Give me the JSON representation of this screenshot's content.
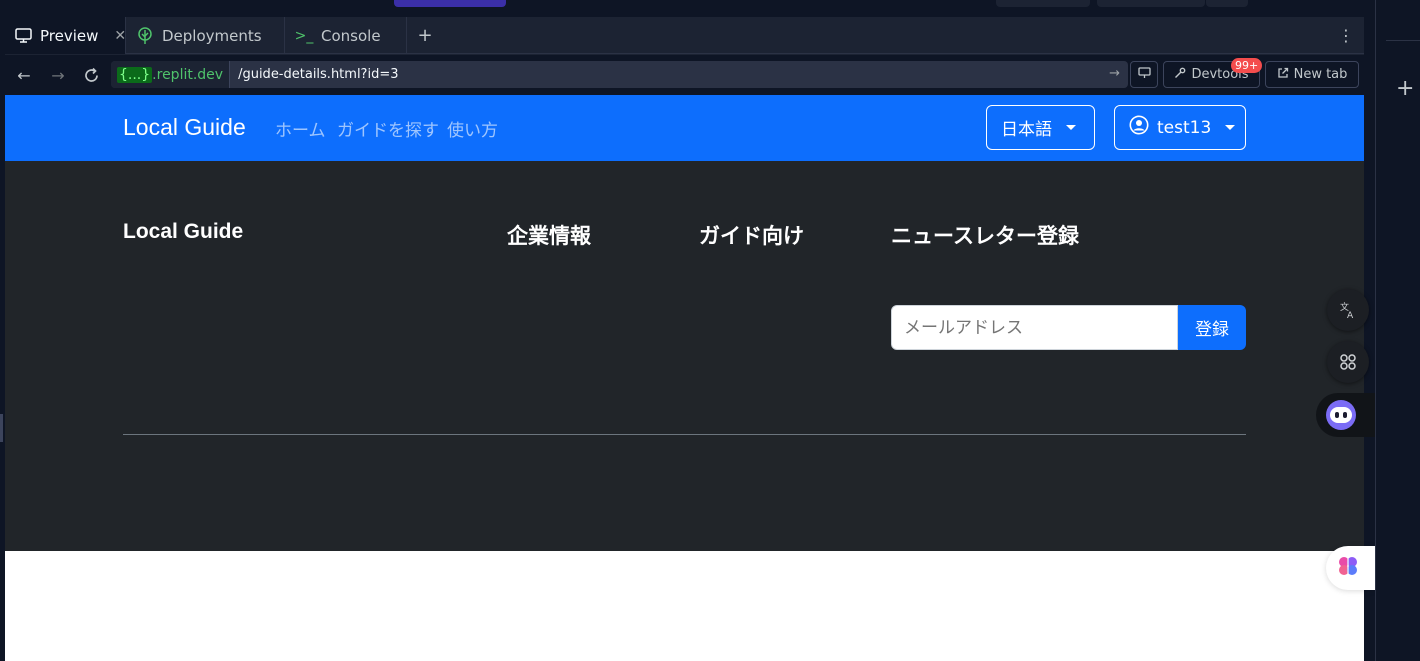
{
  "workspace": {
    "tabs": [
      {
        "label": "Preview",
        "icon": "monitor-icon",
        "active": true
      },
      {
        "label": "Deployments",
        "icon": "deploy-icon",
        "active": false
      },
      {
        "label": "Console",
        "icon": "terminal-icon",
        "active": false
      }
    ],
    "add_tab": "+",
    "more": "⋮"
  },
  "urlbar": {
    "domain_brace": "{...}",
    "domain": ".replit.dev",
    "path": "/guide-details.html?id=3",
    "devtools_label": "Devtools",
    "devtools_badge": "99+",
    "new_tab_label": "New tab"
  },
  "site": {
    "brand": "Local Guide",
    "nav_links": [
      "ホーム",
      "ガイドを探す",
      "使い方"
    ],
    "language_label": "日本語",
    "user_label": "test13"
  },
  "footer": {
    "col_brand": "Local Guide",
    "col_company": "企業情報",
    "col_guides": "ガイド向け",
    "col_newsletter": "ニュースレター登録",
    "newsletter_placeholder": "メールアドレス",
    "subscribe_label": "登録"
  },
  "colors": {
    "navbar": "#0d6efd",
    "footer": "#212529",
    "ide_bg": "#0e1525",
    "domain_green": "#4fc36b"
  }
}
